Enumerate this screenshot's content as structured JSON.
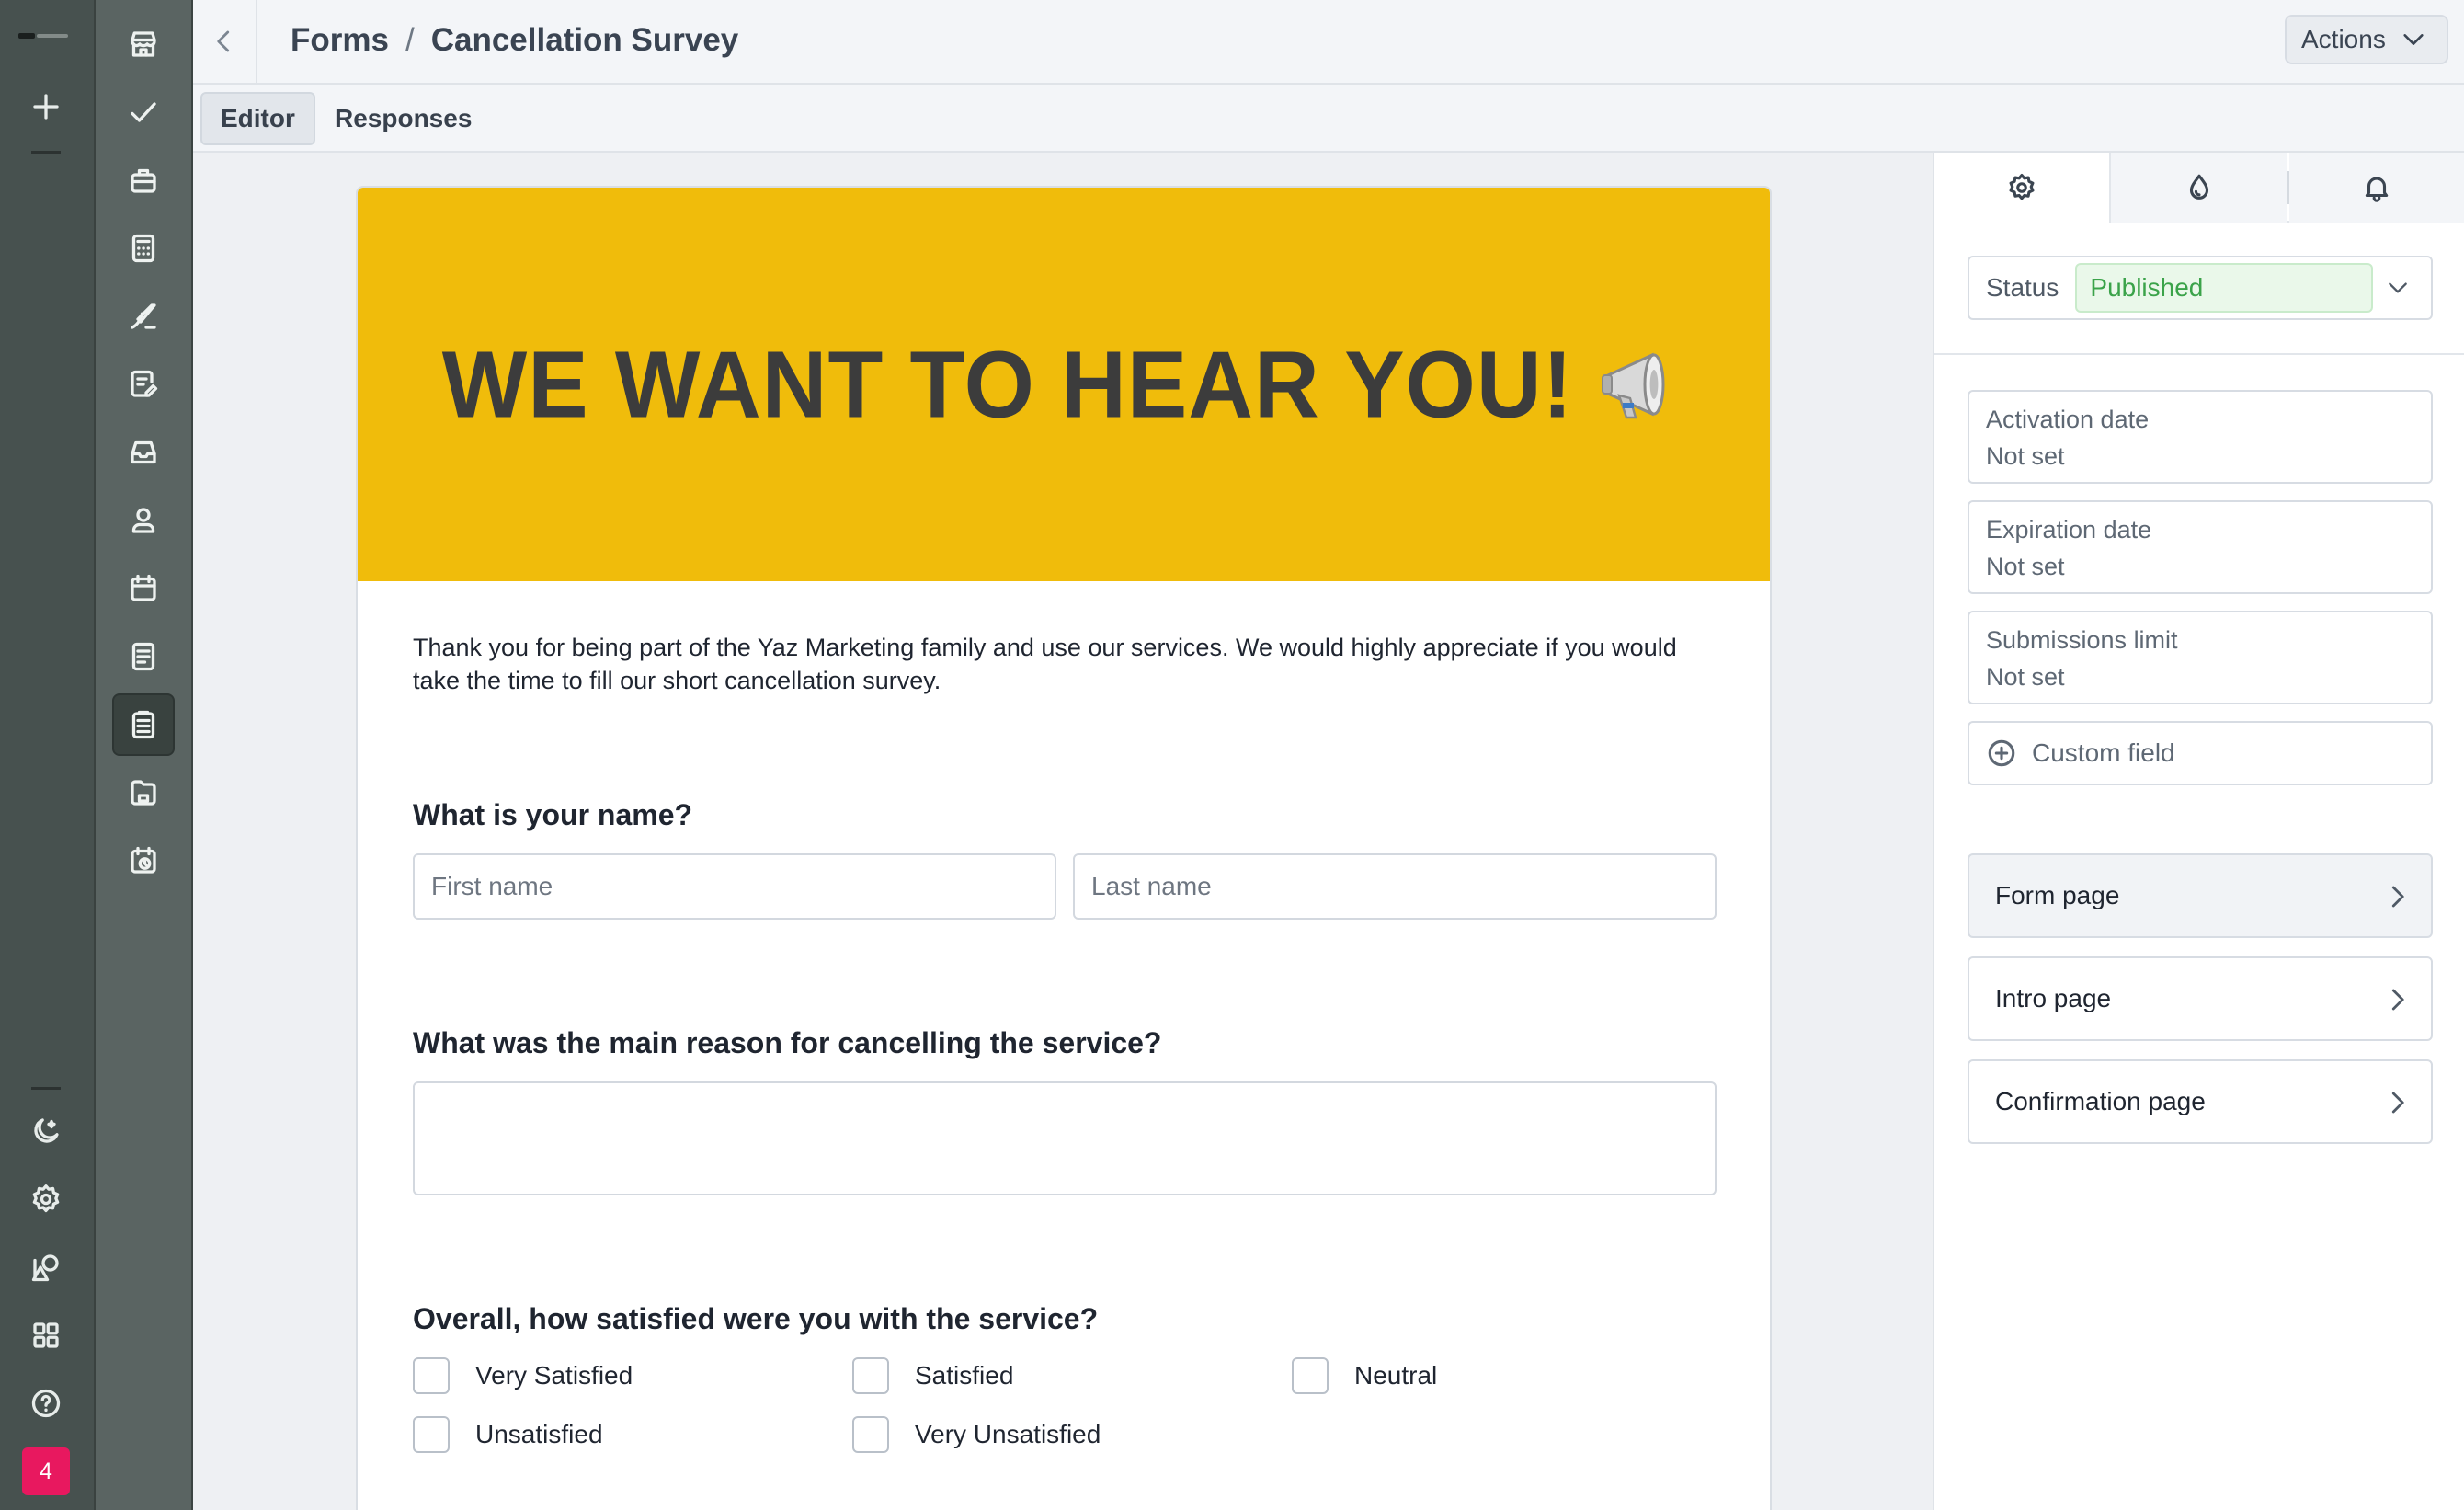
{
  "header": {
    "breadcrumb_root": "Forms",
    "breadcrumb_separator": "/",
    "breadcrumb_current": "Cancellation Survey",
    "actions_label": "Actions"
  },
  "tabs": [
    {
      "label": "Editor",
      "active": true
    },
    {
      "label": "Responses",
      "active": false
    }
  ],
  "rail": {
    "top_icons": [
      "logo",
      "plus-icon"
    ],
    "bottom_icons": [
      "moon-icon",
      "gear-icon",
      "shapes-icon",
      "apps-grid-icon",
      "help-icon"
    ],
    "badge_count": "4",
    "badge_color": "#e8185f"
  },
  "sidebar_icons": [
    "storefront-icon",
    "checkmark-icon",
    "briefcase-icon",
    "calculator-icon",
    "pen-icon",
    "document-edit-icon",
    "inbox-icon",
    "contact-icon",
    "calendar-icon",
    "notes-icon",
    "forms-clipboard-icon",
    "folder-icon",
    "calendar-clock-icon"
  ],
  "form": {
    "banner_title": "WE WANT TO HEAR YOU!",
    "banner_color": "#f0bc0b",
    "intro_text": "Thank you for being part of the Yaz Marketing family and use our services. We would highly appreciate if you would take the time to fill our short cancellation survey.",
    "q1": {
      "title": "What is your name?",
      "first_placeholder": "First name",
      "last_placeholder": "Last name"
    },
    "q2": {
      "title": "What was the main reason for cancelling the service?"
    },
    "q3": {
      "title": "Overall, how satisfied were you with the service?",
      "options": [
        "Very Satisfied",
        "Satisfied",
        "Neutral",
        "Unsatisfied",
        "Very Unsatisfied"
      ]
    }
  },
  "panel": {
    "tabs": [
      "gear-icon",
      "droplet-icon",
      "bell-icon"
    ],
    "status_label": "Status",
    "status_value": "Published",
    "status_color": "#3ba34a",
    "activation_label": "Activation date",
    "activation_value": "Not set",
    "expiration_label": "Expiration date",
    "expiration_value": "Not set",
    "submissions_label": "Submissions limit",
    "submissions_value": "Not set",
    "custom_field_label": "Custom field",
    "pages": [
      "Form page",
      "Intro page",
      "Confirmation page"
    ]
  }
}
